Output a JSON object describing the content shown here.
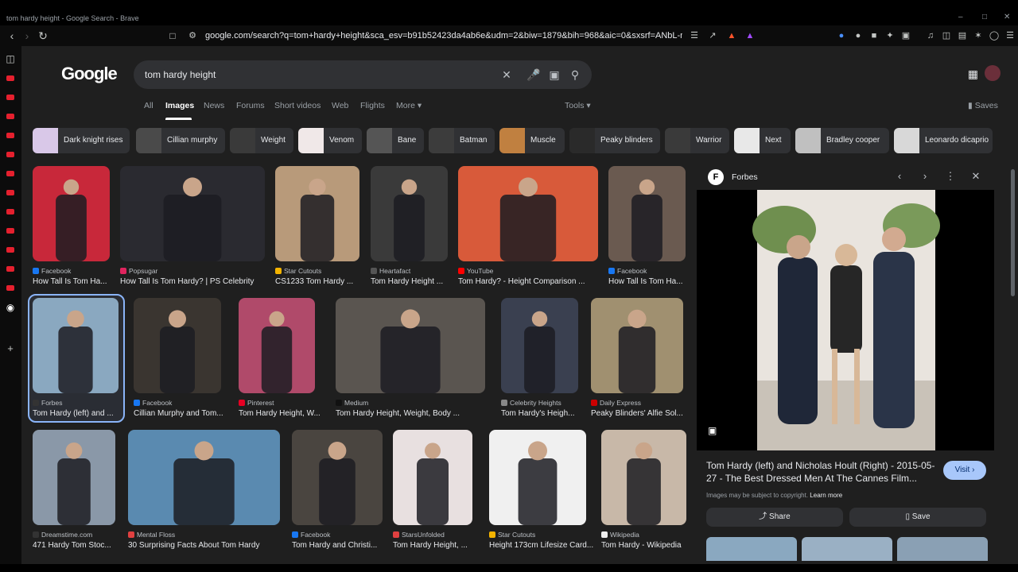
{
  "window": {
    "title": "tom hardy height - Google Search - Brave",
    "min": "–",
    "max": "□",
    "close": "✕"
  },
  "browser": {
    "url": "google.com/search?q=tom+hardy+height&sca_esv=b91b52423da4ab6e&udm=2&biw=1879&bih=968&aic=0&sxsrf=ANbL-n62gbwoUsQVh..."
  },
  "search": {
    "logo": "Google",
    "query": "tom hardy height"
  },
  "tabs": [
    "All",
    "Images",
    "News",
    "Forums",
    "Short videos",
    "Web",
    "Flights",
    "More ▾"
  ],
  "tools": "Tools ▾",
  "saves": "Saves",
  "chips": [
    {
      "label": "Dark knight rises",
      "color": "#d9c8e8"
    },
    {
      "label": "Cillian murphy",
      "color": "#4a4a4a"
    },
    {
      "label": "Weight",
      "color": "#3a3a3a"
    },
    {
      "label": "Venom",
      "color": "#f0e8e8"
    },
    {
      "label": "Bane",
      "color": "#555"
    },
    {
      "label": "Batman",
      "color": "#3c3c3c"
    },
    {
      "label": "Muscle",
      "color": "#c08040"
    },
    {
      "label": "Peaky blinders",
      "color": "#2a2a2a"
    },
    {
      "label": "Warrior",
      "color": "#3a3a3a"
    },
    {
      "label": "Next",
      "color": "#e8e8e8"
    },
    {
      "label": "Bradley cooper",
      "color": "#c0c0c0"
    },
    {
      "label": "Leonardo dicaprio",
      "color": "#d8d8d8"
    }
  ],
  "results": [
    {
      "source": "Facebook",
      "caption": "How Tall Is Tom Ha...",
      "color": "#c8283a",
      "icon": "#1877f2"
    },
    {
      "source": "Popsugar",
      "caption": "How Tall Is Tom Hardy? | PS Celebrity",
      "color": "#2a2a30",
      "icon": "#e0245e"
    },
    {
      "source": "Star Cutouts",
      "caption": "CS1233 Tom Hardy ...",
      "color": "#b89a7a",
      "icon": "#f4b400"
    },
    {
      "source": "Heartafact",
      "caption": "Tom Hardy Height ...",
      "color": "#3a3a3a",
      "icon": "#555"
    },
    {
      "source": "YouTube",
      "caption": "Tom Hardy? - Height Comparison ...",
      "color": "#d85a3a",
      "icon": "#ff0000"
    },
    {
      "source": "Facebook",
      "caption": "How Tall Is Tom Ha...",
      "color": "#6a5a50",
      "icon": "#1877f2"
    },
    {
      "source": "Forbes",
      "caption": "Tom Hardy (left) and ...",
      "color": "#8aa8c0",
      "icon": "#333"
    },
    {
      "source": "Facebook",
      "caption": "Cillian Murphy and Tom...",
      "color": "#3a3530",
      "icon": "#1877f2"
    },
    {
      "source": "Pinterest",
      "caption": "Tom Hardy Height, W...",
      "color": "#b04a6a",
      "icon": "#e60023"
    },
    {
      "source": "Medium",
      "caption": "Tom Hardy Height, Weight, Body ...",
      "color": "#5a5550",
      "icon": "#111"
    },
    {
      "source": "Celebrity Heights",
      "caption": "Tom Hardy's Heigh...",
      "color": "#3a4050",
      "icon": "#888"
    },
    {
      "source": "Daily Express",
      "caption": "Peaky Blinders' Alfie Sol...",
      "color": "#a09070",
      "icon": "#c00"
    },
    {
      "source": "Dreamstime.com",
      "caption": "471 Hardy Tom Stoc...",
      "color": "#8a98a8",
      "icon": "#333"
    },
    {
      "source": "Mental Floss",
      "caption": "30 Surprising Facts About Tom Hardy",
      "color": "#5a8ab0",
      "icon": "#e04040"
    },
    {
      "source": "Facebook",
      "caption": "Tom Hardy and Christi...",
      "color": "#4a4540",
      "icon": "#1877f2"
    },
    {
      "source": "StarsUnfolded",
      "caption": "Tom Hardy Height, ...",
      "color": "#e8e0e0",
      "icon": "#e04040"
    },
    {
      "source": "Star Cutouts",
      "caption": "Height 173cm Lifesize Card...",
      "color": "#f0f0f0",
      "icon": "#f4b400"
    },
    {
      "source": "Wikipedia",
      "caption": "Tom Hardy - Wikipedia",
      "color": "#c8b8a8",
      "icon": "#eee"
    }
  ],
  "panel": {
    "site": "Forbes",
    "logo_letter": "F",
    "title": "Tom Hardy (left) and Nicholas Hoult (Right) - 2015-05-27 - The Best Dressed Men At The Cannes Film...",
    "visit": "Visit ›",
    "copyright": "Images may be subject to copyright.",
    "learn_more": "Learn more",
    "share": "⤴ Share",
    "save": "▯ Save"
  }
}
